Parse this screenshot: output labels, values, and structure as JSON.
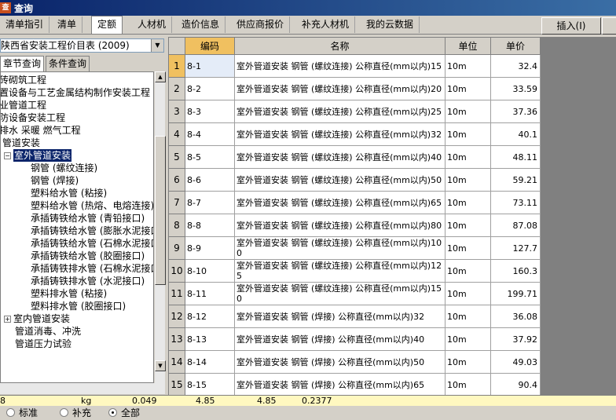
{
  "window": {
    "title": "查询",
    "icon_text": "查"
  },
  "tabs": [
    {
      "label": "清单指引",
      "active": false
    },
    {
      "label": "清单",
      "active": false
    },
    {
      "label": "定额",
      "active": true
    },
    {
      "label": "人材机",
      "active": false
    },
    {
      "label": "造价信息",
      "active": false
    },
    {
      "label": "供应商报价",
      "active": false
    },
    {
      "label": "补充人材机",
      "active": false
    },
    {
      "label": "我的云数据",
      "active": false
    }
  ],
  "insert_button": "插入(I)",
  "catalog_select": {
    "value": "陕西省安装工程价目表 (2009)"
  },
  "subtabs": [
    {
      "label": "章节查询",
      "active": true
    },
    {
      "label": "条件查询",
      "active": false
    }
  ],
  "tree": [
    {
      "label": "砖砌筑工程",
      "selected": false
    },
    {
      "label": "置设备与工艺金属结构制作安装工程",
      "selected": false
    },
    {
      "label": "业管道工程",
      "selected": false
    },
    {
      "label": "防设备安装工程",
      "selected": false
    },
    {
      "label": "排水 采暖 燃气工程",
      "selected": false
    },
    {
      "label": "管道安装",
      "selected": false
    },
    {
      "label": "室外管道安装",
      "selected": true
    },
    {
      "label": "钢管 (螺纹连接)",
      "selected": false
    },
    {
      "label": "钢管 (焊接)",
      "selected": false
    },
    {
      "label": "塑料给水管 (粘接)",
      "selected": false
    },
    {
      "label": "塑料给水管 (热熔、电熔连接)",
      "selected": false
    },
    {
      "label": "承插铸铁给水管 (青铅接口)",
      "selected": false
    },
    {
      "label": "承插铸铁给水管 (膨胀水泥接口)",
      "selected": false
    },
    {
      "label": "承插铸铁给水管 (石棉水泥接口)",
      "selected": false
    },
    {
      "label": "承插铸铁给水管 (胶圈接口)",
      "selected": false
    },
    {
      "label": "承插铸铁排水管 (石棉水泥接口)",
      "selected": false
    },
    {
      "label": "承插铸铁排水管 (水泥接口)",
      "selected": false
    },
    {
      "label": "塑料排水管 (粘接)",
      "selected": false
    },
    {
      "label": "塑料排水管 (胶圈接口)",
      "selected": false
    },
    {
      "label": "室内管道安装",
      "selected": false
    },
    {
      "label": "管道消毒、冲洗",
      "selected": false
    },
    {
      "label": "管道压力试验",
      "selected": false
    }
  ],
  "radios": [
    {
      "label": "标准",
      "checked": false
    },
    {
      "label": "补充",
      "checked": false
    },
    {
      "label": "全部",
      "checked": true
    }
  ],
  "table": {
    "headers": [
      "编码",
      "名称",
      "单位",
      "单价"
    ],
    "rows": [
      {
        "no": "1",
        "code": "8-1",
        "name": "室外管道安装 钢管 (螺纹连接) 公称直径(mm以内)15",
        "unit": "10m",
        "price": "32.4"
      },
      {
        "no": "2",
        "code": "8-2",
        "name": "室外管道安装 钢管 (螺纹连接) 公称直径(mm以内)20",
        "unit": "10m",
        "price": "33.59"
      },
      {
        "no": "3",
        "code": "8-3",
        "name": "室外管道安装 钢管 (螺纹连接) 公称直径(mm以内)25",
        "unit": "10m",
        "price": "37.36"
      },
      {
        "no": "4",
        "code": "8-4",
        "name": "室外管道安装 钢管 (螺纹连接) 公称直径(mm以内)32",
        "unit": "10m",
        "price": "40.1"
      },
      {
        "no": "5",
        "code": "8-5",
        "name": "室外管道安装 钢管 (螺纹连接) 公称直径(mm以内)40",
        "unit": "10m",
        "price": "48.11"
      },
      {
        "no": "6",
        "code": "8-6",
        "name": "室外管道安装 钢管 (螺纹连接) 公称直径(mm以内)50",
        "unit": "10m",
        "price": "59.21"
      },
      {
        "no": "7",
        "code": "8-7",
        "name": "室外管道安装 钢管 (螺纹连接) 公称直径(mm以内)65",
        "unit": "10m",
        "price": "73.11"
      },
      {
        "no": "8",
        "code": "8-8",
        "name": "室外管道安装 钢管 (螺纹连接) 公称直径(mm以内)80",
        "unit": "10m",
        "price": "87.08"
      },
      {
        "no": "9",
        "code": "8-9",
        "name": "室外管道安装 钢管 (螺纹连接) 公称直径(mm以内)100",
        "unit": "10m",
        "price": "127.7"
      },
      {
        "no": "10",
        "code": "8-10",
        "name": "室外管道安装 钢管 (螺纹连接) 公称直径(mm以内)125",
        "unit": "10m",
        "price": "160.3"
      },
      {
        "no": "11",
        "code": "8-11",
        "name": "室外管道安装 钢管 (螺纹连接) 公称直径(mm以内)150",
        "unit": "10m",
        "price": "199.71"
      },
      {
        "no": "12",
        "code": "8-12",
        "name": "室外管道安装 钢管 (焊接) 公称直径(mm以内)32",
        "unit": "10m",
        "price": "36.08"
      },
      {
        "no": "13",
        "code": "8-13",
        "name": "室外管道安装 钢管 (焊接) 公称直径(mm以内)40",
        "unit": "10m",
        "price": "37.92"
      },
      {
        "no": "14",
        "code": "8-14",
        "name": "室外管道安装 钢管 (焊接) 公称直径(mm以内)50",
        "unit": "10m",
        "price": "49.03"
      },
      {
        "no": "15",
        "code": "8-15",
        "name": "室外管道安装 钢管 (焊接) 公称直径(mm以内)65",
        "unit": "10m",
        "price": "90.4"
      }
    ]
  },
  "status_row": {
    "col1": "8",
    "col2": "kg",
    "col3": "0.049",
    "col4": "4.85",
    "col5": "4.85",
    "col6": "0.2377"
  }
}
